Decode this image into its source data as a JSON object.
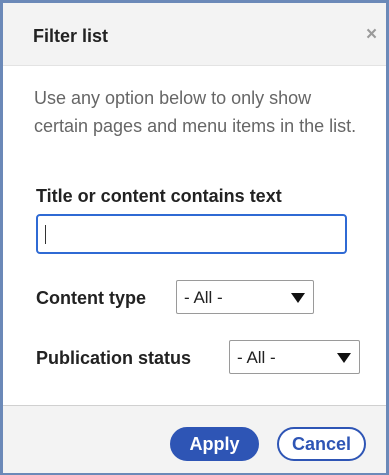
{
  "dialog": {
    "title": "Filter list",
    "close_glyph": "×",
    "close_icon": "close-icon",
    "description": "Use any option below to only show certain pages and menu items in the list."
  },
  "filters": {
    "text_label": "Title or content contains text",
    "text_value": "",
    "content_type_label": "Content type",
    "content_type_value": "- All -",
    "status_label": "Publication status",
    "status_value": "- All -"
  },
  "actions": {
    "apply_label": "Apply",
    "cancel_label": "Cancel"
  },
  "colors": {
    "accent": "#2e55b5",
    "frame": "#6b89b8",
    "focus": "#2f6ad4"
  }
}
